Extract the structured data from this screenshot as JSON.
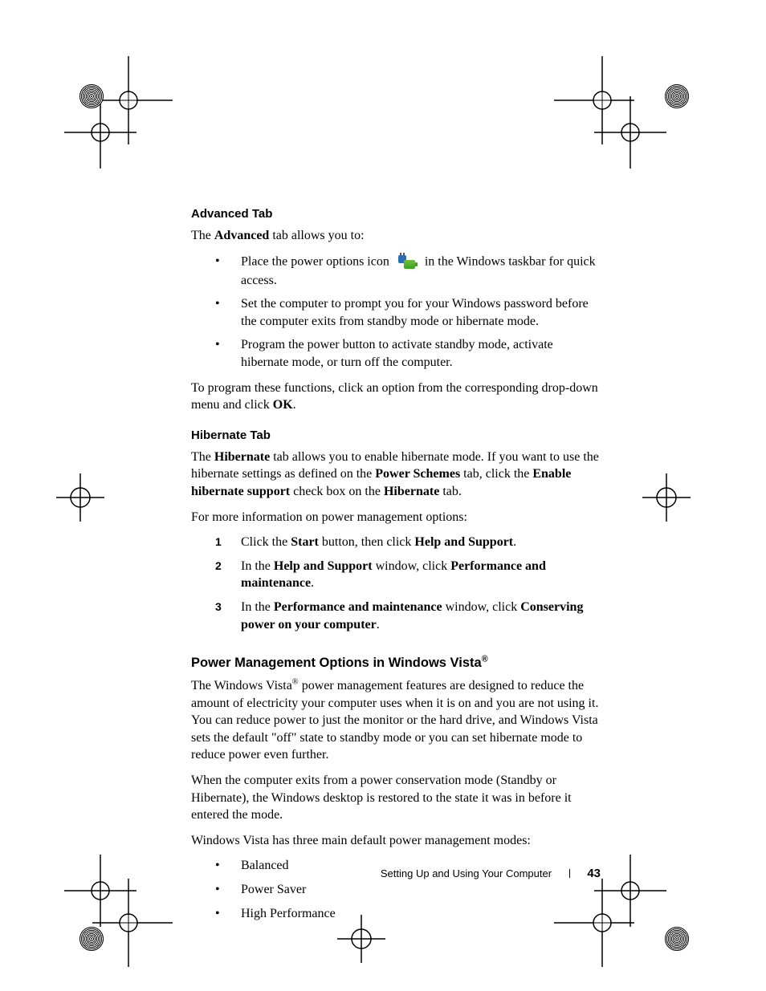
{
  "sections": {
    "advanced": {
      "heading": "Advanced Tab",
      "intro_pre": "The ",
      "intro_bold": "Advanced",
      "intro_post": " tab allows you to:",
      "bullets": [
        {
          "pre": "Place the power options icon ",
          "post": " in the Windows taskbar for quick access.",
          "has_icon": true
        },
        {
          "text": "Set the computer to prompt you for your Windows password before the computer exits from standby mode or hibernate mode."
        },
        {
          "text": "Program the power button to activate standby mode, activate hibernate mode, or turn off the computer."
        }
      ],
      "outro_pre": "To program these functions, click an option from the corresponding drop-down menu and click ",
      "outro_bold": "OK",
      "outro_post": "."
    },
    "hibernate": {
      "heading": "Hibernate Tab",
      "p1": {
        "t1": "The ",
        "b1": "Hibernate",
        "t2": " tab allows you to enable hibernate mode. If you want to use the hibernate settings as defined on the ",
        "b2": "Power Schemes",
        "t3": " tab, click the ",
        "b3": "Enable hibernate support",
        "t4": " check box on the ",
        "b4": "Hibernate",
        "t5": " tab."
      },
      "lead": "For more information on power management options:",
      "steps": [
        {
          "t1": "Click the ",
          "b1": "Start",
          "t2": " button, then click ",
          "b2": "Help and Support",
          "t3": "."
        },
        {
          "t1": "In the ",
          "b1": "Help and Support",
          "t2": " window, click ",
          "b2": "Performance and maintenance",
          "t3": "."
        },
        {
          "t1": "In the ",
          "b1": "Performance and maintenance",
          "t2": " window, click ",
          "b2": "Conserving power on your computer",
          "t3": "."
        }
      ]
    },
    "vista": {
      "heading_pre": "Power Management Options in Windows Vista",
      "reg": "®",
      "p1_pre": "The Windows Vista",
      "p1_post": " power management features are designed to reduce the amount of electricity your computer uses when it is on and you are not using it. You can reduce power to just the monitor or the hard drive, and Windows Vista sets the default \"off\" state to standby mode or you can set hibernate mode to reduce power even further.",
      "p2": "When the computer exits from a power conservation mode (Standby or Hibernate), the Windows desktop is restored to the state it was in before it entered the mode.",
      "p3": "Windows Vista has three main default power management modes:",
      "modes": [
        "Balanced",
        "Power Saver",
        "High Performance"
      ]
    }
  },
  "footer": {
    "section_title": "Setting Up and Using Your Computer",
    "page_number": "43"
  }
}
